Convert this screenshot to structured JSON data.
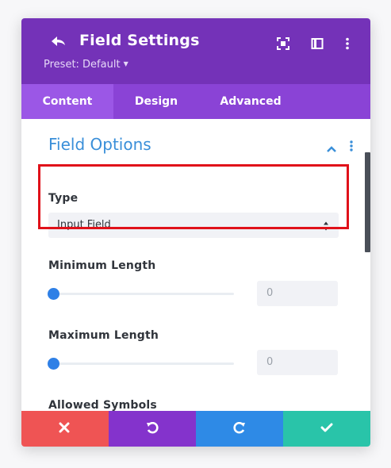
{
  "header": {
    "title": "Field Settings",
    "preset": "Preset: Default"
  },
  "tabs": [
    {
      "label": "Content",
      "active": true
    },
    {
      "label": "Design",
      "active": false
    },
    {
      "label": "Advanced",
      "active": false
    }
  ],
  "section": {
    "title": "Field Options"
  },
  "fields": {
    "type": {
      "label": "Type",
      "value": "Input Field"
    },
    "min_length": {
      "label": "Minimum Length",
      "value": "0"
    },
    "max_length": {
      "label": "Maximum Length",
      "value": "0"
    },
    "allowed_symbols": {
      "label": "Allowed Symbols"
    }
  },
  "colors": {
    "header_bg": "#7432b8",
    "tabs_bg": "#8a43d6",
    "section_title": "#3a8fd9",
    "slider_knob": "#2f80e6",
    "highlight": "#e0111a",
    "cancel": "#ef5454",
    "undo": "#8433cc",
    "redo": "#2e8ae6",
    "save": "#29c4a9"
  },
  "icons": {
    "back": "back-arrow-icon",
    "focus": "focus-icon",
    "sidebar": "sidebar-layout-icon",
    "more": "more-vertical-icon",
    "collapse": "chevron-up-icon",
    "select_arrows": "sort-arrows-icon",
    "cancel": "close-icon",
    "undo": "undo-icon",
    "redo": "redo-icon",
    "save": "check-icon"
  }
}
